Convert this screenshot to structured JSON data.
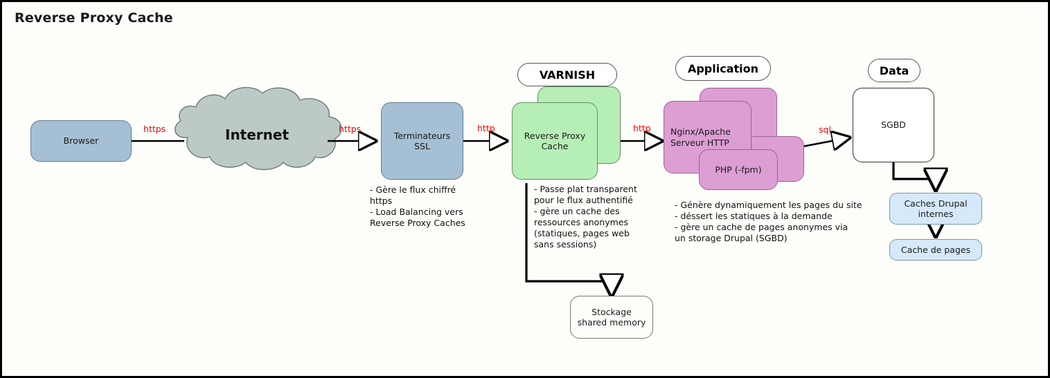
{
  "title": "Reverse Proxy Cache",
  "colors": {
    "background": "#fdfdfa",
    "browser_fill": "#a5c0d4",
    "cloud_fill": "#bcc9c7",
    "ssl_fill": "#a5c0d4",
    "varnish_fill": "#b6efb6",
    "application_fill": "#dc9ed3",
    "data_fill": "#ffffff",
    "cache_fill": "#d6e9fb",
    "protocol_label": "#ff0000",
    "stroke": "#000000"
  },
  "nodes": {
    "browser": "Browser",
    "internet": "Internet",
    "ssl": "Terminateurs\nSSL",
    "varnish_box": "Reverse Proxy\nCache",
    "nginx": "Nginx/Apache\nServeur HTTP",
    "php": "PHP (-fpm)",
    "sgbd": "SGBD",
    "stockage": "Stockage\nshared memory",
    "caches_drupal": "Caches Drupal\ninternes",
    "cache_pages": "Cache de pages"
  },
  "group_labels": {
    "varnish": "VARNISH",
    "application": "Application",
    "data": "Data"
  },
  "protocols": {
    "browser_to_internet": "https",
    "internet_to_ssl": "https",
    "ssl_to_varnish": "http",
    "varnish_to_app": "http",
    "app_to_data": "sql"
  },
  "notes": {
    "ssl": "- Gère le flux chiffré\n  https\n- Load Balancing vers\n  Reverse Proxy Caches",
    "varnish": "- Passe plat transparent\n   pour le flux authentifié\n- gère un cache des\n   ressources anonymes\n  (statiques, pages web\n  sans sessions)",
    "application": "- Génère dynamiquement les pages du site\n- déssert les statiques à la demande\n- gère un cache de pages anonymes via\n  un storage Drupal (SGBD)"
  }
}
